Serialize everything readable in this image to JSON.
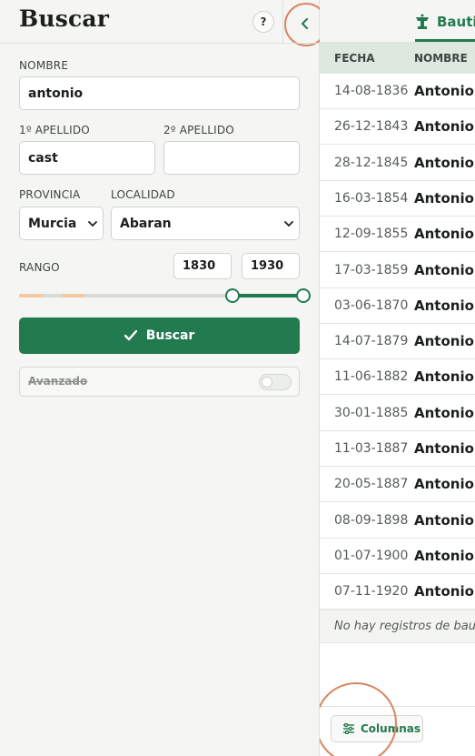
{
  "search_panel": {
    "title": "Buscar",
    "help_label": "?",
    "nombre": {
      "label": "NOMBRE",
      "value": "antonio"
    },
    "apellido1": {
      "label": "1º APELLIDO",
      "value": "cast"
    },
    "apellido2": {
      "label": "2º APELLIDO",
      "value": ""
    },
    "provincia": {
      "label": "PROVINCIA",
      "value": "Murcia"
    },
    "localidad": {
      "label": "LOCALIDAD",
      "value": "Abaran"
    },
    "rango": {
      "label": "RANGO",
      "from": "1830",
      "to": "1930"
    },
    "search_button": "Buscar",
    "advanced_label": "Avanzado"
  },
  "results": {
    "tab_label": "Bautismos",
    "columns": [
      "FECHA",
      "NOMBRE"
    ],
    "rows": [
      {
        "fecha": "14-08-1836",
        "nombre": "Antonio"
      },
      {
        "fecha": "26-12-1843",
        "nombre": "Antonio"
      },
      {
        "fecha": "28-12-1845",
        "nombre": "Antonio"
      },
      {
        "fecha": "16-03-1854",
        "nombre": "Antonio F"
      },
      {
        "fecha": "12-09-1855",
        "nombre": "Antonio L"
      },
      {
        "fecha": "17-03-1859",
        "nombre": "Antonio F"
      },
      {
        "fecha": "03-06-1870",
        "nombre": "Antonio I"
      },
      {
        "fecha": "14-07-1879",
        "nombre": "Antonio E"
      },
      {
        "fecha": "11-06-1882",
        "nombre": "Antonio E"
      },
      {
        "fecha": "30-01-1885",
        "nombre": "Antonio"
      },
      {
        "fecha": "11-03-1887",
        "nombre": "Antonio E"
      },
      {
        "fecha": "20-05-1887",
        "nombre": "Antonio"
      },
      {
        "fecha": "08-09-1898",
        "nombre": "Antonio"
      },
      {
        "fecha": "01-07-1900",
        "nombre": "Antonio C"
      },
      {
        "fecha": "07-11-1920",
        "nombre": "Antonio"
      }
    ],
    "no_records_text": "No hay registros de bautismos",
    "columns_button": "Columnas"
  },
  "colors": {
    "accent": "#227a4f",
    "highlight_ring": "#d98562",
    "header_bg": "#dfe8df"
  }
}
